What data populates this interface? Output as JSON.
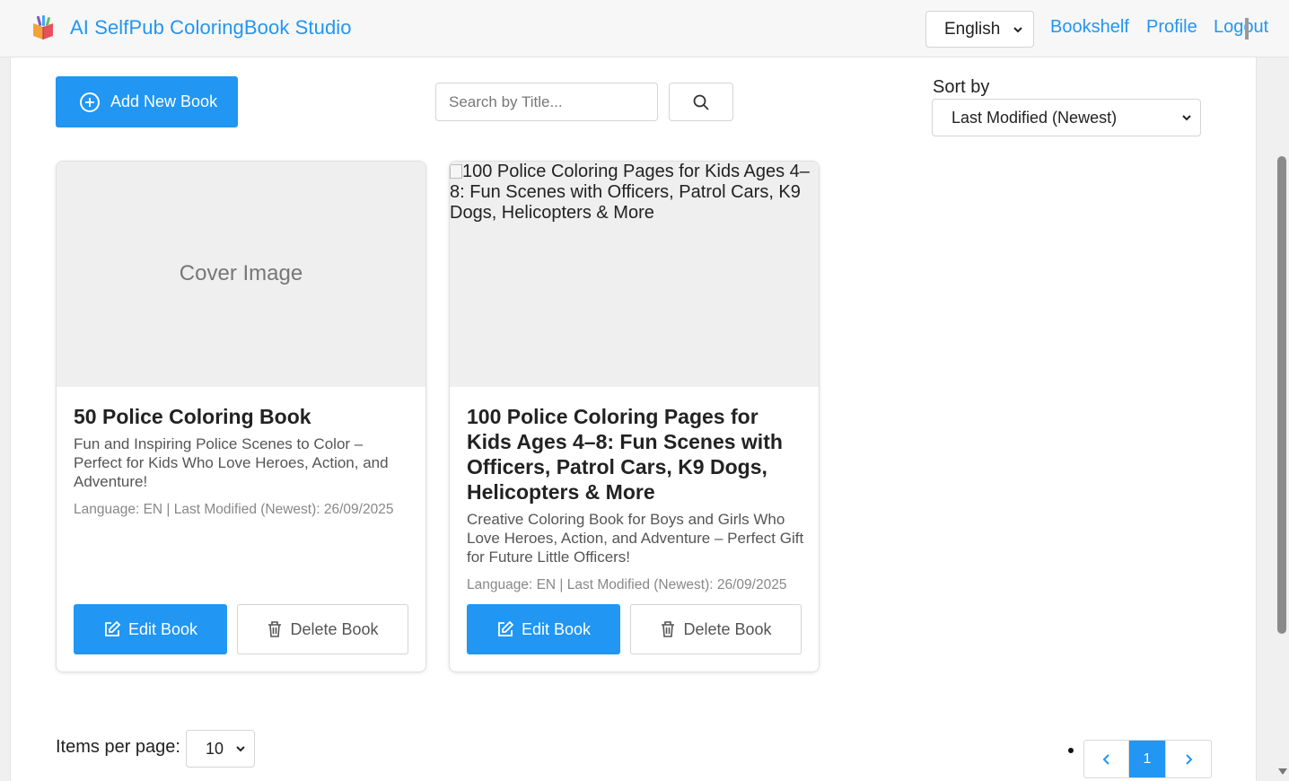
{
  "header": {
    "app_title": "AI SelfPub ColoringBook Studio",
    "language": "English",
    "nav": {
      "bookshelf": "Bookshelf",
      "profile": "Profile",
      "logout": "Logout"
    }
  },
  "toolbar": {
    "add_book_label": "Add New Book",
    "search_placeholder": "Search by Title...",
    "sort_label": "Sort by",
    "sort_value": "Last Modified (Newest)"
  },
  "books": [
    {
      "cover_placeholder": "Cover Image",
      "title": "50 Police Coloring Book",
      "subtitle": "Fun and Inspiring Police Scenes to Color – Perfect for Kids Who Love Heroes, Action, and Adventure!",
      "meta": "Language: EN | Last Modified (Newest): 26/09/2025",
      "edit_label": "Edit Book",
      "delete_label": "Delete Book"
    },
    {
      "cover_alt": "100 Police Coloring Pages for Kids Ages 4–8: Fun Scenes with Officers, Patrol Cars, K9 Dogs, Helicopters & More",
      "title": "100 Police Coloring Pages for Kids Ages 4–8: Fun Scenes with Officers, Patrol Cars, K9 Dogs, Helicopters & More",
      "subtitle": "Creative Coloring Book for Boys and Girls Who Love Heroes, Action, and Adventure – Perfect Gift for Future Little Officers!",
      "meta": "Language: EN | Last Modified (Newest): 26/09/2025",
      "edit_label": "Edit Book",
      "delete_label": "Delete Book"
    }
  ],
  "footer": {
    "items_per_page_label": "Items per page:",
    "items_per_page_value": "10",
    "current_page": "1"
  },
  "colors": {
    "accent": "#2196f3",
    "muted_text": "#888888"
  }
}
